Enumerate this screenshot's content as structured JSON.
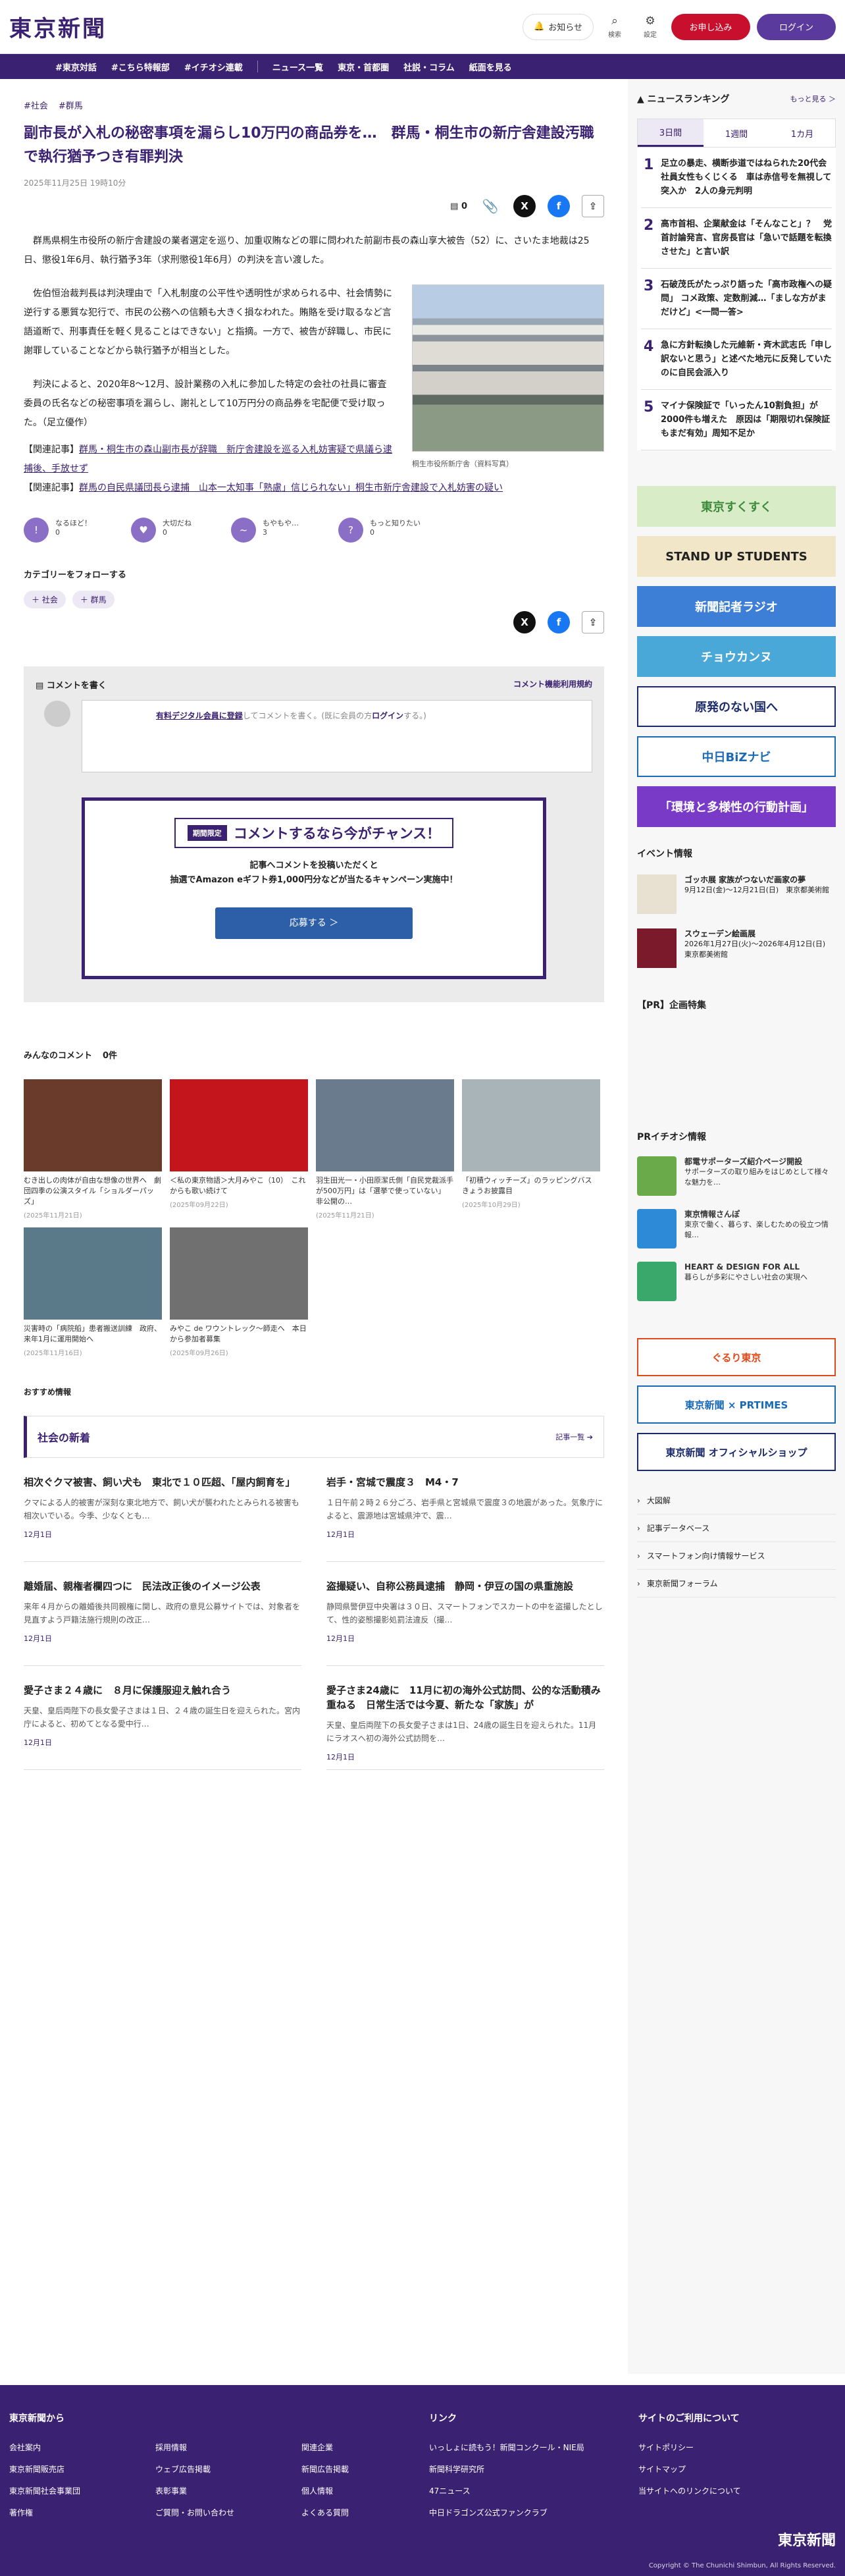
{
  "header": {
    "logo": "東京新聞",
    "notify": "お知らせ",
    "search": "検索",
    "settings": "設定",
    "subscribe": "お申し込み",
    "login": "ログイン"
  },
  "nav": [
    "#東京対話",
    "#こちら特報部",
    "#イチオシ連載",
    "ニュース一覧",
    "東京・首都圏",
    "社説・コラム",
    "紙面を見る"
  ],
  "article": {
    "tags": [
      "#社会",
      "#群馬"
    ],
    "title": "副市長が入札の秘密事項を漏らし10万円の商品券を…　群馬・桐生市の新庁舎建設汚職で執行猶予つき有罪判決",
    "date": "2025年11月25日 19時10分",
    "comment_count": "0",
    "p1": "群馬県桐生市役所の新庁舎建設の業者選定を巡り、加重収賄などの罪に問われた前副市長の森山享大被告（52）に、さいたま地裁は25日、懲役1年6月、執行猶予3年（求刑懲役1年6月）の判決を言い渡した。",
    "p2": "佐伯恒治裁判長は判決理由で「入札制度の公平性や透明性が求められる中、社会情勢に逆行する悪質な犯行で、市民の公務への信頼も大きく損なわれた。賄賂を受け取るなど言語道断で、刑事責任を軽く見ることはできない」と指摘。一方で、被告が辞職し、市民に謝罪していることなどから執行猶予が相当とした。",
    "p3": "判決によると、2020年8～12月、設計業務の入札に参加した特定の会社の社員に審査委員の氏名などの秘密事項を漏らし、謝礼として10万円分の商品券を宅配便で受け取った。（足立優作）",
    "caption": "桐生市役所新庁舎（資料写真）",
    "rel1_label": "【関連記事】",
    "rel1": "群馬・桐生市の森山副市長が辞職　新庁舎建設を巡る入札妨害疑で県議ら逮捕後、手放せず",
    "rel2_label": "【関連記事】",
    "rel2": "群馬の自民県議団長ら逮捕　山本一太知事「熟慮」信じられない」桐生市新庁舎建設で入札妨害の疑い"
  },
  "reactions": [
    {
      "icon": "!",
      "label": "なるほど！",
      "count": "0"
    },
    {
      "icon": "♥",
      "label": "大切だね",
      "count": "0"
    },
    {
      "icon": "~",
      "label": "もやもや…",
      "count": "3"
    },
    {
      "icon": "?",
      "label": "もっと知りたい",
      "count": "0"
    }
  ],
  "follow": {
    "label": "カテゴリーをフォローする",
    "chips": [
      "＋ 社会",
      "＋ 群馬"
    ]
  },
  "comment": {
    "title": "コメントを書く",
    "rules": "コメント機能利用規約",
    "prompt1": "有料デジタル会員に登録",
    "prompt2": "してコメントを書く。(既に会員の方",
    "prompt3": "ログイン",
    "prompt4": "する。)"
  },
  "promo": {
    "limited": "期間限定",
    "title": "コメントするなら今がチャンス！",
    "line1": "記事へコメントを投稿いただくと",
    "line2": "抽選でAmazon eギフト券1,000円分などが当たるキャンペーン実施中！",
    "apply": "応募する ＞"
  },
  "comments": {
    "title": "みんなのコメント",
    "count": "0件"
  },
  "gallery": [
    {
      "t": "むき出しの肉体が自由な想像の世界へ　劇団四季の公演スタイル「ショルダーパッズ」",
      "d": "(2025年11月21日)",
      "c": "#6a3a2a"
    },
    {
      "t": "＜私の東京物語＞大月みやこ（10）　これからも歌い続けて",
      "d": "(2025年09月22日)",
      "c": "#c4141c"
    },
    {
      "t": "羽生田光一・小田原潔氏側「自民党裁派手が500万円」は「選挙で使っていない」 非公開の…",
      "d": "(2025年11月21日)",
      "c": "#6a7b8e"
    },
    {
      "t": "「初積ウィッチーズ」のラッピングバス　きょうお披露目",
      "d": "(2025年10月29日)",
      "c": "#a8b4b8"
    },
    {
      "t": "災害時の「病院船」患者搬送訓練　政府、来年1月に運用開始へ",
      "d": "(2025年11月16日)",
      "c": "#5a7a8a"
    },
    {
      "t": "みやこ de ワウントレック〜師走へ　本日から参加者募集",
      "d": "(2025年09月26日)",
      "c": "#707070"
    }
  ],
  "recommend": "おすすめ情報",
  "section": {
    "name": "社会の新着",
    "more": "記事一覧 ➔"
  },
  "news": [
    {
      "h": "相次ぐクマ被害、飼い犬も　東北で１０匹超、「屋内飼育を」",
      "p": "クマによる人的被害が深刻な東北地方で、飼い犬が襲われたとみられる被害も相次いでいる。今季、少なくとも…",
      "d": "12月1日"
    },
    {
      "h": "岩手・宮城で震度３　M4・7",
      "p": "１日午前２時２６分ごろ、岩手県と宮城県で震度３の地震があった。気象庁によると、震源地は宮城県沖で、震…",
      "d": "12月1日"
    },
    {
      "h": "離婚届、親権者欄四つに　民法改正後のイメージ公表",
      "p": "来年４月からの離婚後共同親権に関し、政府の意見公募サイトでは、対象者を見直すよう戸籍法施行規則の改正…",
      "d": "12月1日"
    },
    {
      "h": "盗撮疑い、自称公務員逮捕　静岡・伊豆の国の県重施設",
      "p": "静岡県警伊豆中央署は３０日、スマートフォンでスカートの中を盗撮したとして、性的姿態撮影処罰法違反（撮…",
      "d": "12月1日"
    },
    {
      "h": "愛子さま２４歳に　８月に保護服迎え触れ合う",
      "p": "天皇、皇后両陛下の長女愛子さまは１日、２４歳の誕生日を迎えられた。宮内庁によると、初めてとなる愛中行…",
      "d": "12月1日"
    },
    {
      "h": "愛子さま24歳に　11月に初の海外公式訪問、公的な活動積み重ねる　日常生活では今夏、新たな「家族」が",
      "p": "天皇、皇后両陛下の長女愛子さまは1日、24歳の誕生日を迎えられた。11月にラオスへ初の海外公式訪問を…",
      "d": "12月1日"
    }
  ],
  "ranking": {
    "title": "ニュースランキング",
    "more": "もっと見る ＞",
    "tabs": [
      "3日間",
      "1週間",
      "1カ月"
    ],
    "items": [
      "足立の暴走、横断歩道ではねられた20代会社員女性もくじくる　車は赤信号を無視して突入か　2人の身元判明",
      "高市首相、企業献金は「そんなこと」？　党首討論発言、官房長官は「急いで話題を転換させた」と言い訳",
      "石破茂氏がたっぷり語った「高市政権への疑問」 コメ政策、定数削減…「ましな方がまだけど」<一問一答>",
      "急に方針転換した元維新・斉木武志氏「申し訳ないと思う」と述べた地元に反発していたのに自民会派入り",
      "マイナ保険証で「いったん10割負担」が2000件も増えた　原因は「期限切れ保険証もまだ有効」周知不足か"
    ]
  },
  "banners": [
    {
      "t": "東京すくすく",
      "bg": "#d9ecc8",
      "fg": "#3a8a3a"
    },
    {
      "t": "STAND UP STUDENTS",
      "bg": "#f2e6c8",
      "fg": "#222"
    },
    {
      "t": "新聞記者ラジオ",
      "bg": "#3d7ed6",
      "fg": "#fff"
    },
    {
      "t": "チョウカンヌ",
      "bg": "#4aa8d8",
      "fg": "#fff"
    },
    {
      "t": "原発のない国へ",
      "bg": "#ffffff",
      "fg": "#1b2a6b"
    },
    {
      "t": "中日BiZナビ",
      "bg": "#ffffff",
      "fg": "#1b6ab5"
    },
    {
      "t": "「環境と多様性の行動計画」",
      "bg": "#7a3ac8",
      "fg": "#fff"
    }
  ],
  "events": {
    "title": "イベント情報",
    "items": [
      {
        "t": "ゴッホ展 家族がつないだ画家の夢",
        "s": "9月12日(金)〜12月21日(日)　東京都美術館"
      },
      {
        "t": "スウェーデン絵画展",
        "s": "2026年1月27日(火)〜2026年4月12日(日)　東京都美術館"
      }
    ]
  },
  "pr": {
    "title": "【PR】企画特集",
    "ichioshi": "PRイチオシ情報",
    "items": [
      {
        "t": "都電サポーターズ紹介ページ開設",
        "s": "サポーターズの取り組みをはじめとして様々な魅力を…",
        "c": "#6aaa4a"
      },
      {
        "t": "東京情報さんぽ",
        "s": "東京で働く、暮らす、楽しむための役立つ情報…",
        "c": "#2d8ad6"
      },
      {
        "t": "HEART & DESIGN FOR ALL",
        "s": "暮らしが多彩にやさしい社会の実現へ",
        "c": "#3aa86a"
      }
    ],
    "banners": [
      "ぐるり東京",
      "東京新聞 × PRTIMES",
      "東京新聞 オフィシャルショップ"
    ],
    "links": [
      "大図解",
      "記事データベース",
      "スマートフォン向け情報サービス",
      "東京新聞フォーラム"
    ]
  },
  "footer": {
    "c1": "東京新聞から",
    "c1l": [
      "会社案内",
      "採用情報",
      "関連企業",
      "東京新聞販売店",
      "ウェブ広告掲載",
      "新聞広告掲載",
      "東京新聞社会事業団",
      "表彰事業",
      "個人情報",
      "著作権",
      "ご質問・お問い合わせ",
      "よくある質問"
    ],
    "c2": "リンク",
    "c2l": [
      "いっしょに読もう！新聞コンクール・NIE局",
      "新聞科学研究所",
      "47ニュース",
      "中日ドラゴンズ公式ファンクラブ"
    ],
    "c3": "サイトのご利用について",
    "c3l": [
      "サイトポリシー",
      "サイトマップ",
      "当サイトへのリンクについて"
    ],
    "logo": "東京新聞",
    "copy": "Copyright © The Chunichi Shimbun, All Rights Reserved."
  }
}
